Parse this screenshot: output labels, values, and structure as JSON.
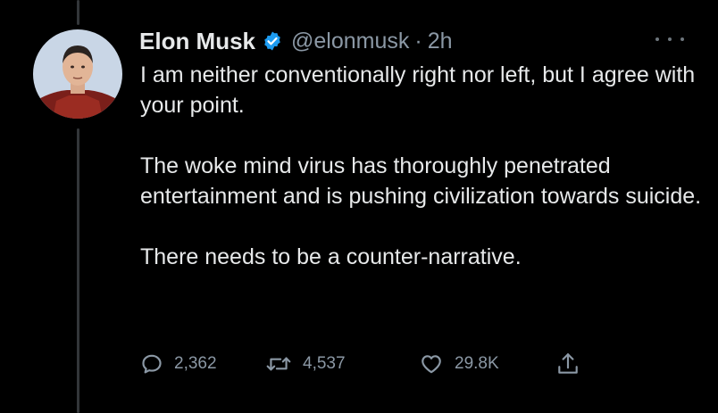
{
  "author": {
    "display_name": "Elon Musk",
    "handle": "@elonmusk",
    "separator": "·",
    "time": "2h",
    "verified": true
  },
  "tweet": {
    "paragraphs": [
      "I am neither conventionally right nor left, but I agree with your point.",
      "The woke mind virus has thoroughly penetrated entertainment and is pushing civilization towards suicide.",
      "There needs to be a counter-narrative."
    ]
  },
  "actions": {
    "replies": "2,362",
    "retweets": "4,537",
    "likes": "29.8K"
  },
  "icons": {
    "verified": "verified-badge-icon",
    "more": "more-options-icon",
    "reply": "reply-icon",
    "retweet": "retweet-icon",
    "like": "heart-icon",
    "share": "share-icon"
  },
  "colors": {
    "background": "#000000",
    "text_primary": "#e7e9ea",
    "text_secondary": "#8b98a5",
    "verified_blue": "#1d9bf0",
    "thread_line": "#333639"
  }
}
